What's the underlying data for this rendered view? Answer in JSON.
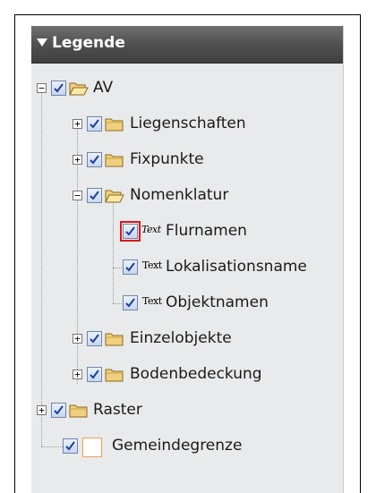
{
  "panel": {
    "title": "Legende",
    "tree": {
      "av": {
        "label": "AV",
        "expander": "−"
      },
      "liegenschaften": {
        "label": "Liegenschaften",
        "expander": "+"
      },
      "fixpunkte": {
        "label": "Fixpunkte",
        "expander": "+"
      },
      "nomenklatur": {
        "label": "Nomenklatur",
        "expander": "−"
      },
      "flurnamen": {
        "label": "Flurnamen",
        "icon_text": "Text"
      },
      "lokalisationsname": {
        "label": "Lokalisationsname",
        "icon_text": "Text"
      },
      "objektnamen": {
        "label": "Objektnamen",
        "icon_text": "Text"
      },
      "einzelobjekte": {
        "label": "Einzelobjekte",
        "expander": "+"
      },
      "bodenbedeckung": {
        "label": "Bodenbedeckung",
        "expander": "+"
      },
      "raster": {
        "label": "Raster",
        "expander": "+"
      },
      "gemeindegrenze": {
        "label": "Gemeindegrenze"
      }
    }
  },
  "colors": {
    "header_bg": "#505050",
    "panel_bg": "#e9eaec",
    "highlight": "#e01616",
    "gemeinde_border": "#f1a04a"
  }
}
